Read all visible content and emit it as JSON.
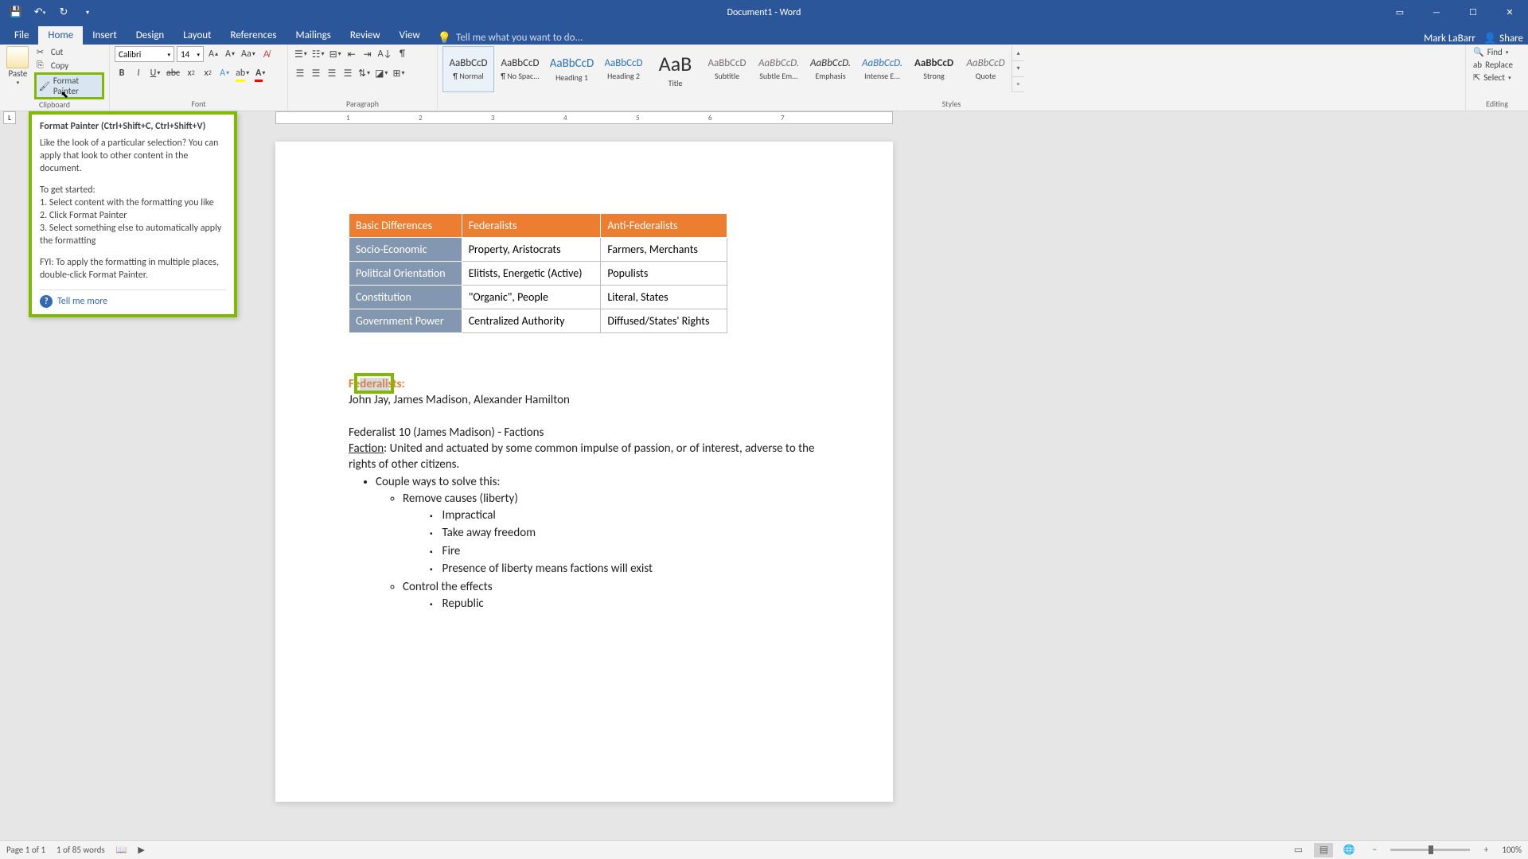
{
  "titlebar": {
    "title": "Document1 - Word"
  },
  "tabs": {
    "file": "File",
    "home": "Home",
    "insert": "Insert",
    "design": "Design",
    "layout": "Layout",
    "references": "References",
    "mailings": "Mailings",
    "review": "Review",
    "view": "View",
    "tellme": "Tell me what you want to do..."
  },
  "user": {
    "name": "Mark LaBarr",
    "share": "Share"
  },
  "clipboard": {
    "paste": "Paste",
    "cut": "Cut",
    "copy": "Copy",
    "painter": "Format Painter",
    "group": "Clipboard"
  },
  "font": {
    "name": "Calibri",
    "size": "14",
    "group": "Font"
  },
  "paragraph": {
    "group": "Paragraph"
  },
  "editing": {
    "find": "Find",
    "replace": "Replace",
    "select": "Select",
    "group": "Editing"
  },
  "styles": {
    "group": "Styles",
    "items": [
      {
        "prev": "AaBbCcD",
        "name": "¶ Normal",
        "sel": true
      },
      {
        "prev": "AaBbCcD",
        "name": "¶ No Spac...",
        "sel": false
      },
      {
        "prev": "AaBbCcD",
        "name": "Heading 1",
        "sel": false,
        "color": "#2e74b5",
        "size": "15px"
      },
      {
        "prev": "AaBbCcD",
        "name": "Heading 2",
        "sel": false,
        "color": "#2e74b5",
        "size": "13px"
      },
      {
        "prev": "AaB",
        "name": "Title",
        "sel": false,
        "size": "26px",
        "weight": "300"
      },
      {
        "prev": "AaBbCcD",
        "name": "Subtitle",
        "sel": false,
        "color": "#767171"
      },
      {
        "prev": "AaBbCcD.",
        "name": "Subtle Em...",
        "sel": false,
        "color": "#767171",
        "italic": true
      },
      {
        "prev": "AaBbCcD.",
        "name": "Emphasis",
        "sel": false,
        "italic": true
      },
      {
        "prev": "AaBbCcD.",
        "name": "Intense E...",
        "sel": false,
        "color": "#2e74b5",
        "italic": true
      },
      {
        "prev": "AaBbCcD",
        "name": "Strong",
        "sel": false,
        "weight": "bold"
      },
      {
        "prev": "AaBbCcD",
        "name": "Quote",
        "sel": false,
        "italic": true,
        "color": "#767171"
      }
    ]
  },
  "tooltip": {
    "title": "Format Painter (Ctrl+Shift+C, Ctrl+Shift+V)",
    "p1": "Like the look of a particular selection? You can apply that look to other content in the document.",
    "p2": "To get started:",
    "l1": "1. Select content with the formatting you like",
    "l2": "2. Click Format Painter",
    "l3": "3. Select something else to automatically apply the formatting",
    "p3": "FYI: To apply the formatting in multiple places, double-click Format Painter.",
    "more": "Tell me more"
  },
  "table": {
    "headers": [
      "Basic Differences",
      "Federalists",
      "Anti-Federalists"
    ],
    "rows": [
      [
        "Socio-Economic",
        "Property, Aristocrats",
        "Farmers, Merchants"
      ],
      [
        "Political Orientation",
        "Elitists, Energetic (Active)",
        "Populists"
      ],
      [
        "Constitution",
        "\"Organic\", People",
        "Literal, States"
      ],
      [
        "Government Power",
        "Centralized Authority",
        "Diffused/States' Rights"
      ]
    ]
  },
  "body": {
    "h": "Federalists:",
    "authors": "John Jay, James Madison, Alexander Hamilton",
    "fed10": "Federalist 10 (James Madison) - Factions",
    "faction_label": "Faction",
    "faction_rest": ": United and actuated by some common impulse of passion, or of interest, adverse to the rights of other citizens.",
    "b1": "Couple ways to solve this:",
    "b2a": "Remove causes (liberty)",
    "b3a": "Impractical",
    "b3b": "Take away freedom",
    "b3c": "Fire",
    "b3d": "Presence of liberty means factions will exist",
    "b2b": "Control the effects",
    "b3e": "Republic"
  },
  "status": {
    "page": "Page 1 of 1",
    "words": "1 of 85 words",
    "zoom": "100%"
  },
  "ruler": {
    "ticks": [
      "1",
      "2",
      "3",
      "4",
      "5",
      "6",
      "7"
    ]
  }
}
